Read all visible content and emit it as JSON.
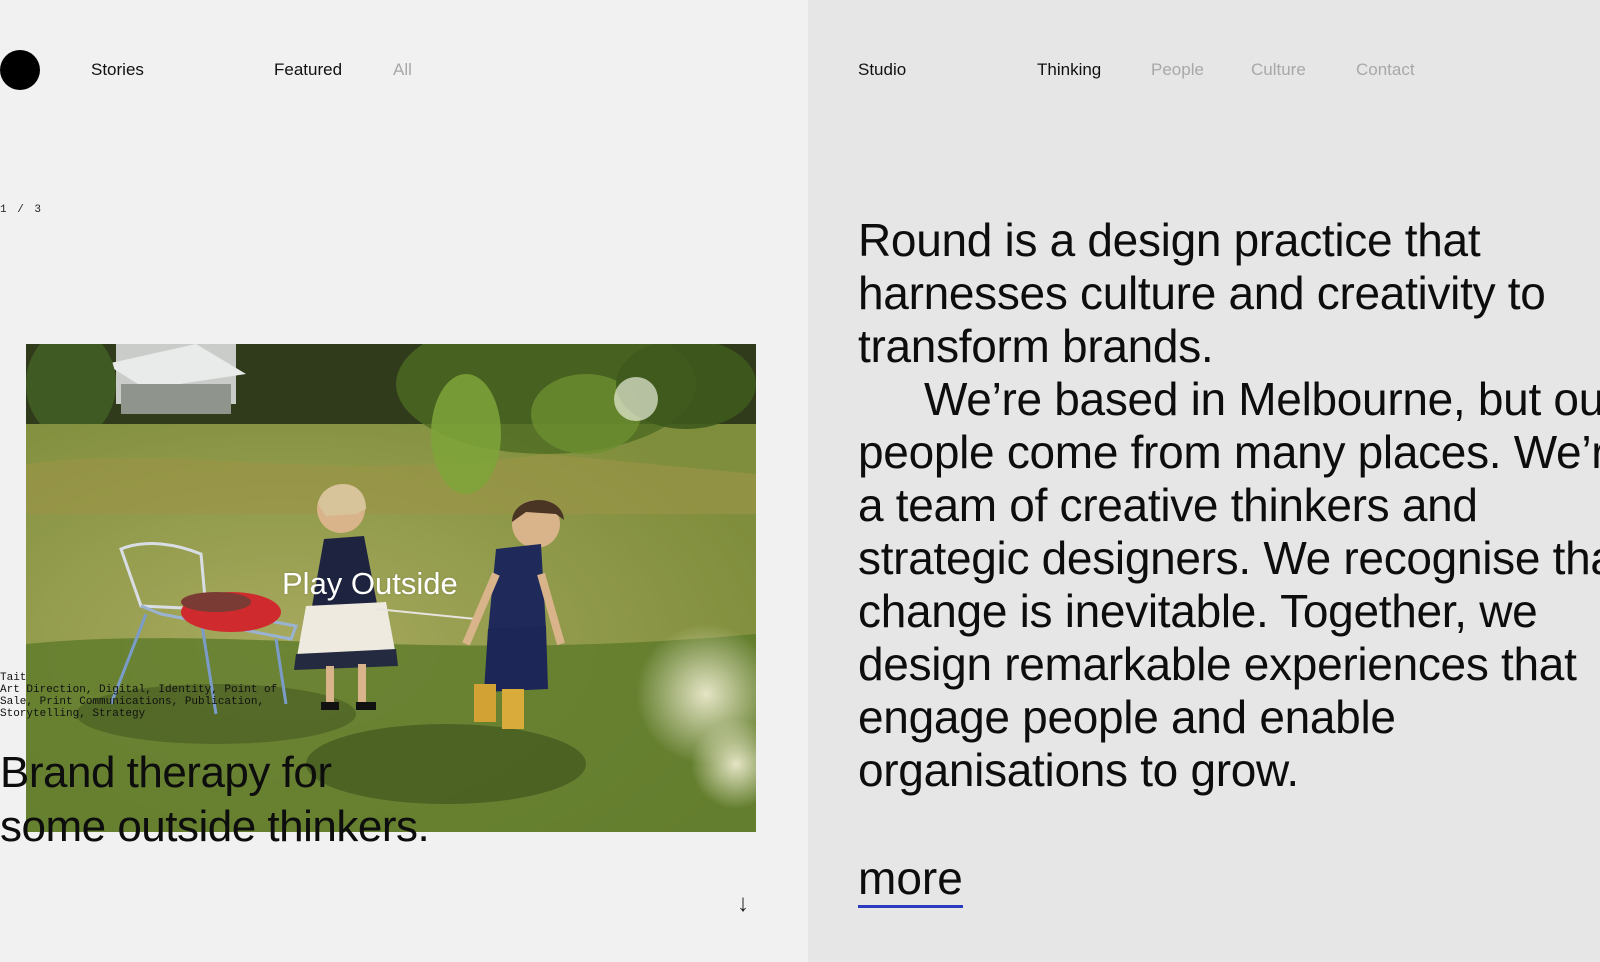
{
  "left_nav": {
    "stories": "Stories",
    "featured": "Featured",
    "all": "All"
  },
  "counter": "1 / 3",
  "feature": {
    "image_caption": "Play Outside",
    "client": "Tait",
    "services_line1": "Art Direction, Digital, Identity, Point of",
    "services_line2": "Sale, Print Communications, Publication,",
    "services_line3": "Storytelling, Strategy",
    "headline": "Brand therapy for some outside thinkers."
  },
  "right_nav": {
    "studio": "Studio",
    "thinking": "Thinking",
    "people": "People",
    "culture": "Culture",
    "contact": "Contact"
  },
  "about": {
    "paragraph1": "Round is a design practice that harnesses culture and creativity to transform brands.",
    "paragraph2": "We’re based in Melbourne, but our people come from many places. We’re a team of creative thinkers and strategic designers. We recognise that change is inevitable. Together, we design remarkable experiences that engage people and enable organisations to grow.",
    "more_label": "more"
  },
  "colors": {
    "left_background": "#f1f1f1",
    "right_background": "#e6e6e6",
    "muted_nav": "#a8a8a8",
    "link_underline": "#2b3bbf"
  },
  "icons": {
    "logo": "black-circle",
    "scroll_down": "down-arrow"
  }
}
